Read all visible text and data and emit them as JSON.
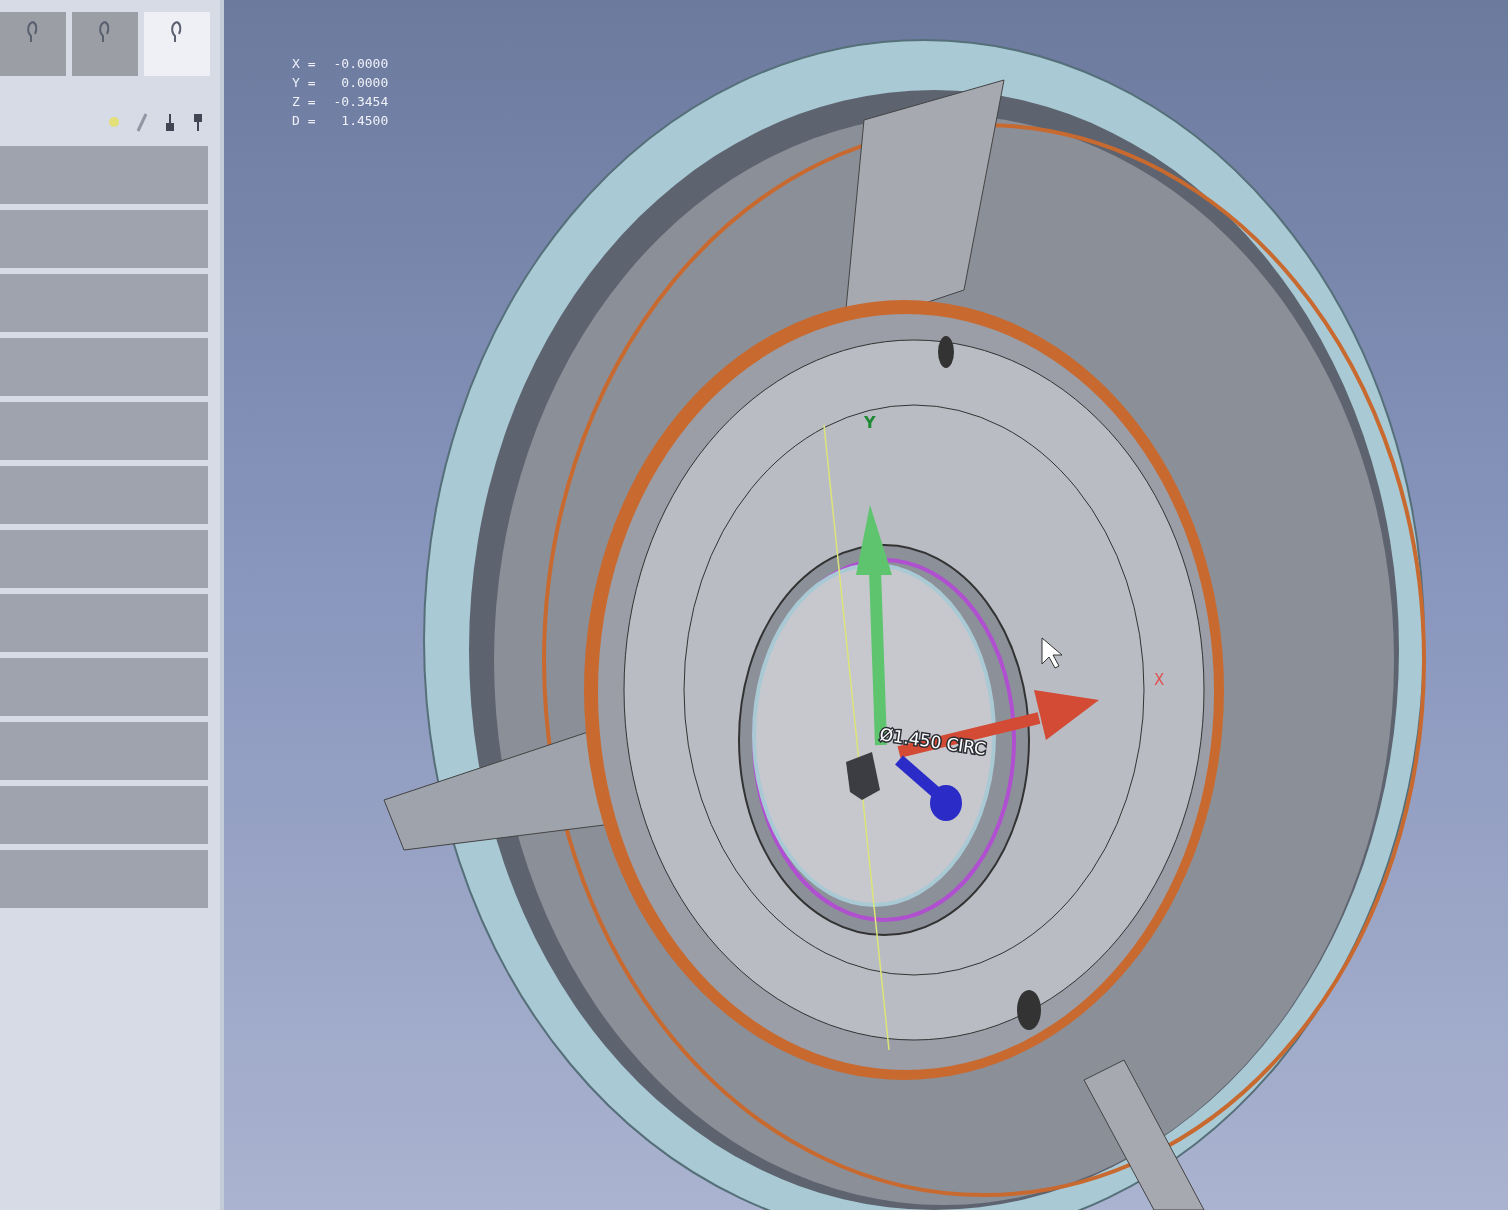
{
  "toolbar": {
    "tools": [
      {
        "selected": false
      },
      {
        "selected": false
      },
      {
        "selected": true
      }
    ]
  },
  "readout": [
    {
      "axis": "X =",
      "value": "-0.0000"
    },
    {
      "axis": "Y =",
      "value": "0.0000"
    },
    {
      "axis": "Z =",
      "value": "-0.3454"
    },
    {
      "axis": "D =",
      "value": "1.4500"
    }
  ],
  "viewport": {
    "feature_label": "Ø1.450 CIRC",
    "axis_labels": [
      "Y",
      "X"
    ]
  }
}
